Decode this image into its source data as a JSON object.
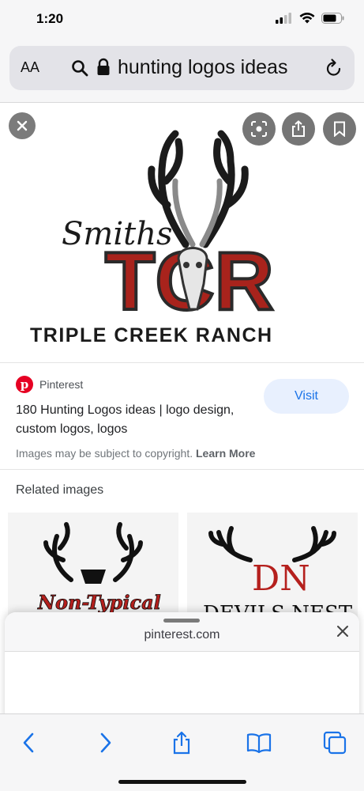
{
  "status_bar": {
    "time": "1:20"
  },
  "address_bar": {
    "text_size_label": "AA",
    "url_text": "hunting logos ideas"
  },
  "viewer": {
    "logo_script_text": "Smiths",
    "logo_letters": "TCR",
    "logo_tagline": "TRIPLE CREEK RANCH"
  },
  "result": {
    "source": "Pinterest",
    "title": "180 Hunting Logos ideas | logo design, custom logos, logos",
    "visit_label": "Visit",
    "copyright_text": "Images may be subject to copyright.",
    "learn_more": "Learn More"
  },
  "related": {
    "heading": "Related images",
    "tiles": [
      {
        "caption": "Non-Typical"
      },
      {
        "caption": "DEVILS NEST",
        "monogram": "DN"
      }
    ]
  },
  "sheet": {
    "domain": "pinterest.com"
  },
  "colors": {
    "accent": "#1a73e8",
    "pinterest_red": "#e60023",
    "logo_red": "#a8231c"
  }
}
